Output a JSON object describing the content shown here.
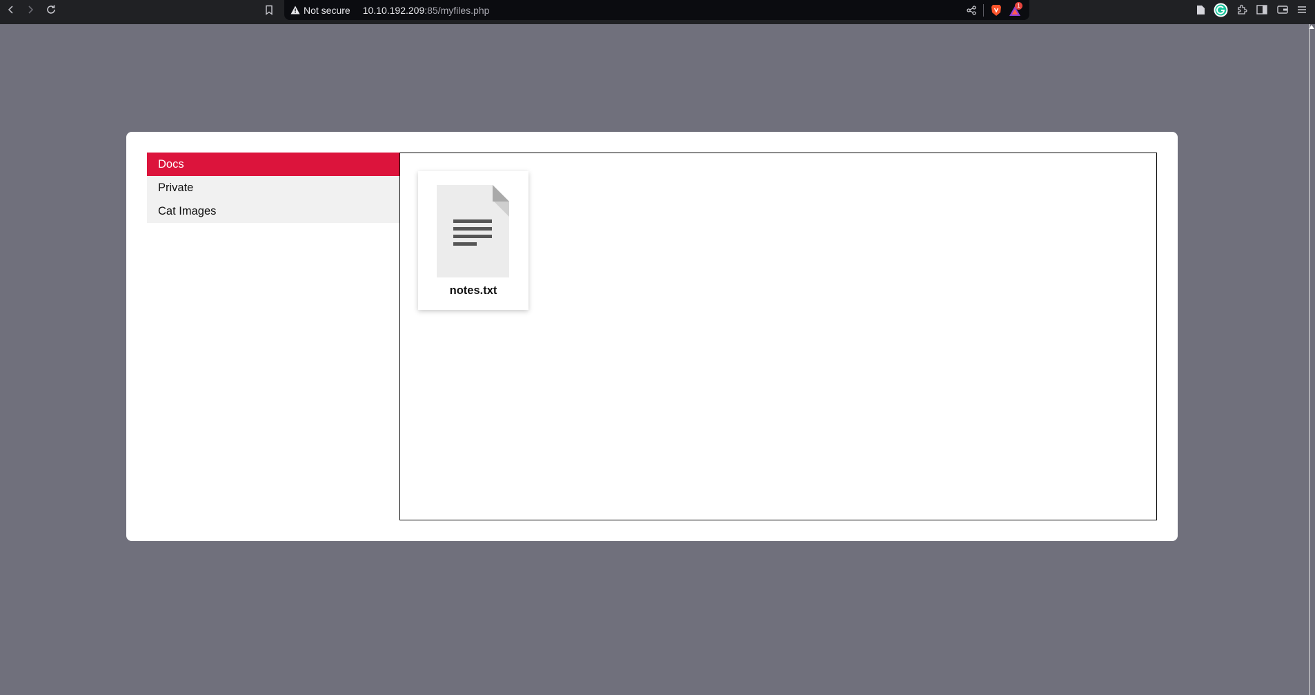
{
  "browser": {
    "security_label": "Not secure",
    "url_host": "10.10.192.209",
    "url_rest": ":85/myfiles.php",
    "badge_count": "1",
    "icons": [
      "back-icon",
      "forward-icon",
      "reload-icon",
      "bookmark-icon",
      "warning-icon",
      "share-icon",
      "brave-shield-icon",
      "brave-rewards-icon",
      "reader-icon",
      "grammarly-icon",
      "extensions-icon",
      "sidebar-icon",
      "wallet-icon",
      "menu-icon"
    ]
  },
  "sidebar": {
    "tabs": [
      {
        "label": "Docs",
        "active": true
      },
      {
        "label": "Private",
        "active": false
      },
      {
        "label": "Cat Images",
        "active": false
      }
    ]
  },
  "files": [
    {
      "name": "notes.txt",
      "icon": "text-file-icon"
    }
  ],
  "colors": {
    "page_bg": "#70707c",
    "active_tab": "#dc143c",
    "inactive_tab": "#f1f1f1"
  }
}
